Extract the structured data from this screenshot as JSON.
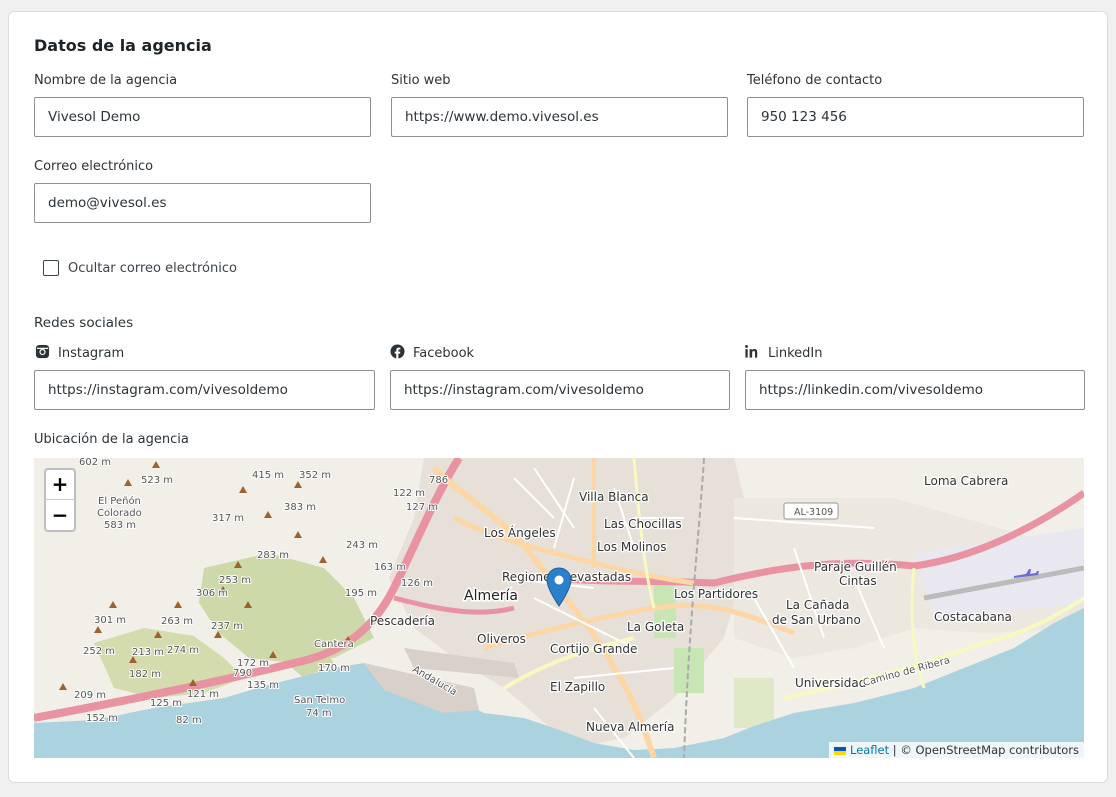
{
  "section_title": "Datos de la agencia",
  "fields": {
    "name": {
      "label": "Nombre de la agencia",
      "value": "Vivesol Demo"
    },
    "website": {
      "label": "Sitio web",
      "value": "https://www.demo.vivesol.es"
    },
    "phone": {
      "label": "Teléfono de contacto",
      "value": "950 123 456"
    },
    "email": {
      "label": "Correo electrónico",
      "value": "demo@vivesol.es"
    }
  },
  "hide_email": {
    "label": "Ocultar correo electrónico",
    "checked": false
  },
  "social": {
    "title": "Redes sociales",
    "instagram": {
      "label": "Instagram",
      "icon": "instagram-icon",
      "value": "https://instagram.com/vivesoldemo"
    },
    "facebook": {
      "label": "Facebook",
      "icon": "facebook-icon",
      "value": "https://instagram.com/vivesoldemo"
    },
    "linkedin": {
      "label": "LinkedIn",
      "icon": "linkedin-icon",
      "value": "https://linkedin.com/vivesoldemo"
    }
  },
  "location": {
    "title": "Ubicación de la agencia",
    "map": {
      "zoom_in": "+",
      "zoom_out": "−",
      "attribution_link": "Leaflet",
      "attribution_text": "| © OpenStreetMap contributors",
      "labels": {
        "almeria": "Almería",
        "villa_blanca": "Villa Blanca",
        "las_chocillas": "Las Chocillas",
        "los_molinos": "Los Molinos",
        "los_angeles": "Los Ángeles",
        "regiones": "Regiones Devastadas",
        "los_partidores": "Los Partidores",
        "la_goleta": "La Goleta",
        "pescaderia": "Pescadería",
        "oliveros": "Oliveros",
        "cortijo_grande": "Cortijo Grande",
        "el_zapillo": "El Zapillo",
        "nueva_almeria": "Nueva Almería",
        "loma_cabrera": "Loma Cabrera",
        "paraje_guillen": "Paraje Guillén",
        "cintas": "Cintas",
        "la_canada": "La Cañada",
        "de_san_urbano": "de San Urbano",
        "costacabana": "Costacabana",
        "universidad": "Universidad",
        "el_penon": "El Peñón",
        "colorado": "Colorado",
        "san_telmo": "San Telmo",
        "al_3109": "AL-3109",
        "andalucia": "Andalucía",
        "camino_ribera": "Camino de Ribera",
        "e_602": "602 m",
        "e_523": "523 m",
        "e_415": "415 m",
        "e_352": "352 m",
        "e_383": "383 m",
        "e_317": "317 m",
        "e_583": "583 m",
        "e_283": "283 m",
        "e_253": "253 m",
        "e_306": "306 m",
        "e_301": "301 m",
        "e_263": "263 m",
        "e_237": "237 m",
        "e_252": "252 m",
        "e_213": "213 m",
        "e_274": "274 m",
        "e_182": "182 m",
        "e_172": "172 m",
        "e_790": "790",
        "e_209": "209 m",
        "e_121": "121 m",
        "e_135": "135 m",
        "e_125": "125 m",
        "e_152": "152 m",
        "e_82": "82 m",
        "e_74": "74 m",
        "e_170": "170 m",
        "e_122": "122 m",
        "e_786": "786",
        "e_243": "243 m",
        "e_163": "163 m",
        "e_126": "126 m",
        "e_195": "195 m",
        "e_127": "127 m",
        "e_cantera": "Cantera"
      }
    }
  },
  "colors": {
    "input_border": "#8c8f94",
    "marker": "#2a81cb",
    "sea": "#aad3df",
    "highway": "#e892a2",
    "primary_road": "#fcd6a4"
  }
}
